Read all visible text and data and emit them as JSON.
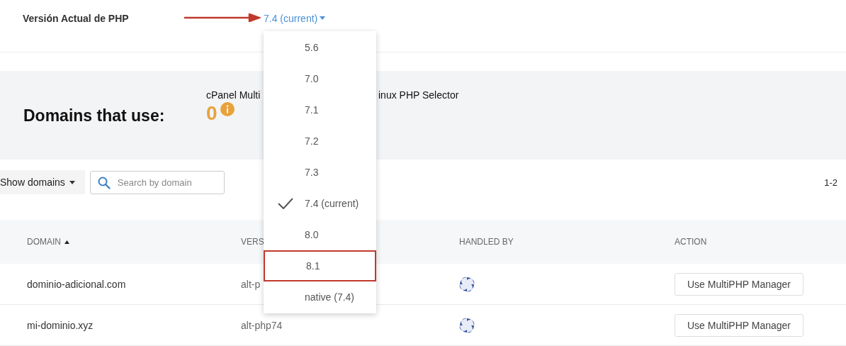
{
  "php_version": {
    "label": "Versión Actual de PHP",
    "current": "7.4 (current)",
    "options": [
      {
        "label": "5.6",
        "selected": false,
        "highlighted": false
      },
      {
        "label": "7.0",
        "selected": false,
        "highlighted": false
      },
      {
        "label": "7.1",
        "selected": false,
        "highlighted": false
      },
      {
        "label": "7.2",
        "selected": false,
        "highlighted": false
      },
      {
        "label": "7.3",
        "selected": false,
        "highlighted": false
      },
      {
        "label": "7.4 (current)",
        "selected": true,
        "highlighted": false
      },
      {
        "label": "8.0",
        "selected": false,
        "highlighted": false
      },
      {
        "label": "8.1",
        "selected": false,
        "highlighted": true
      },
      {
        "label": "native (7.4)",
        "selected": false,
        "highlighted": false
      }
    ]
  },
  "summary": {
    "title": "Domains that use:",
    "handler_left": "cPanel Multi",
    "handler_right": "inux PHP Selector",
    "count": "0"
  },
  "toolbar": {
    "filter": "Show domains",
    "search": {
      "placeholder": "Search by domain"
    },
    "range": "1-2"
  },
  "table": {
    "columns": [
      {
        "label": "DOMAIN",
        "sorted": true
      },
      {
        "label": "VERS",
        "sorted": false
      },
      {
        "label": "HANDLED BY",
        "sorted": false
      },
      {
        "label": "ACTION",
        "sorted": false
      }
    ],
    "rows": [
      {
        "domain": "dominio-adicional.com",
        "version": "alt-p",
        "action": "Use MultiPHP Manager"
      },
      {
        "domain": "mi-dominio.xyz",
        "version": "alt-php74",
        "action": "Use MultiPHP Manager"
      }
    ]
  }
}
